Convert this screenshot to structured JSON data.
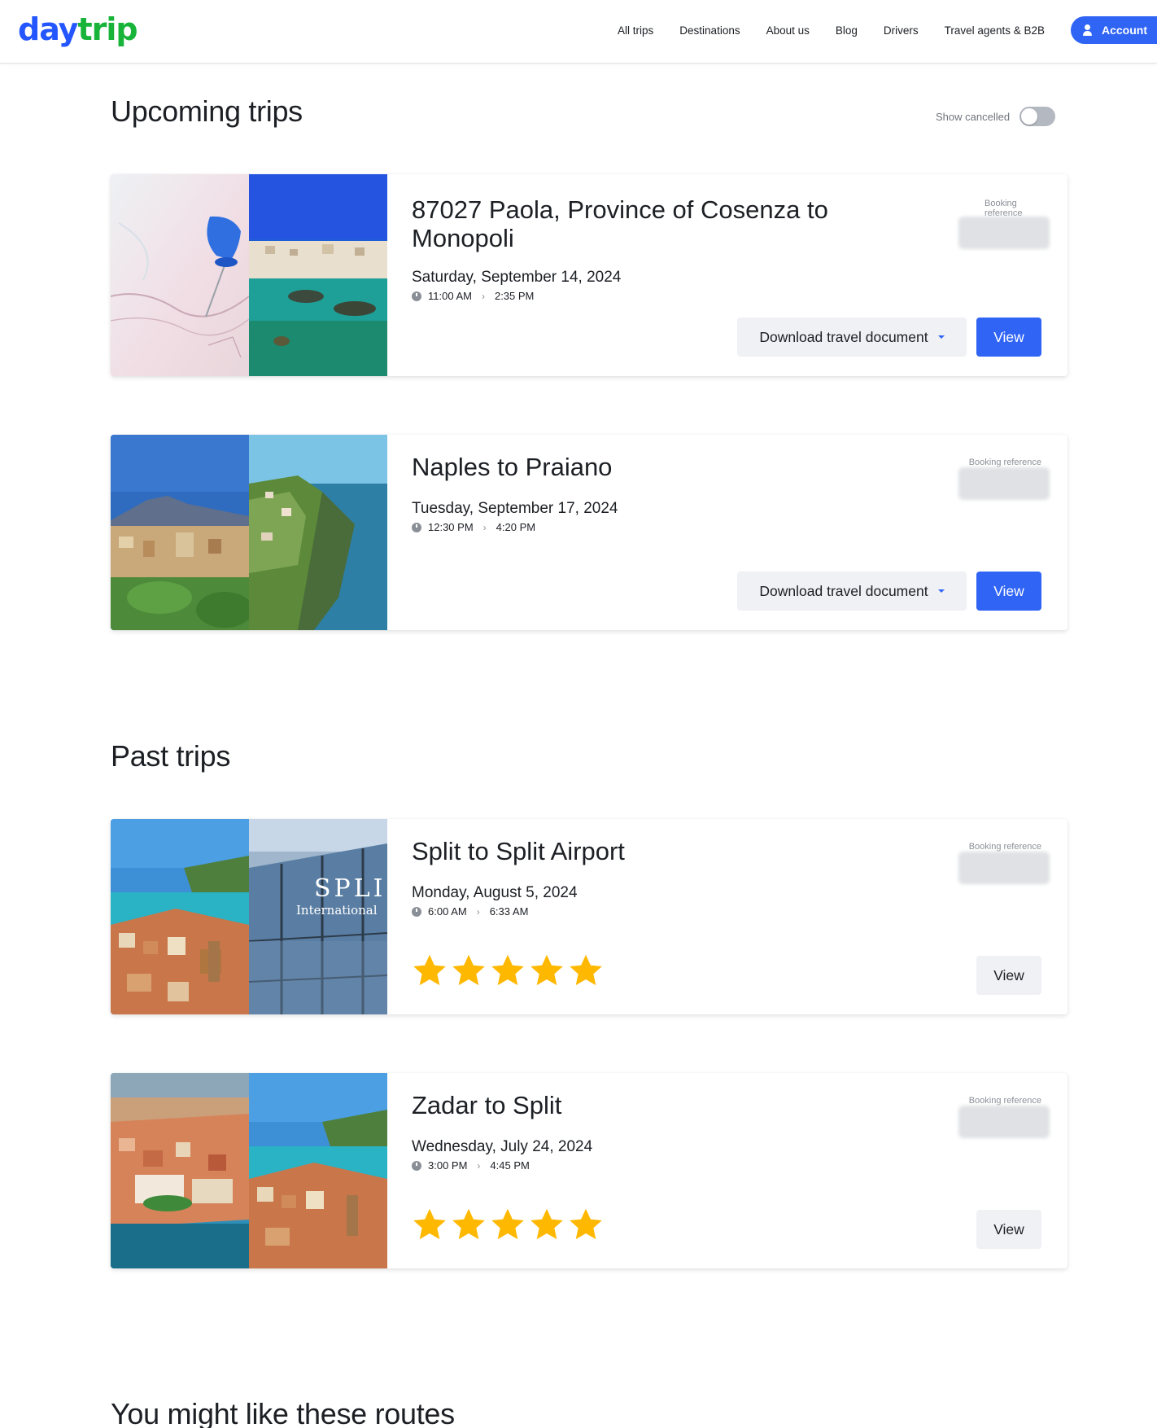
{
  "header": {
    "logo_part1": "day",
    "logo_part2": "trip",
    "nav": [
      "All trips",
      "Destinations",
      "About us",
      "Blog",
      "Drivers",
      "Travel agents & B2B"
    ],
    "account_label": "Account"
  },
  "upcoming": {
    "title": "Upcoming trips",
    "show_cancelled_label": "Show cancelled",
    "show_cancelled_on": false,
    "trips": [
      {
        "title": "87027 Paola, Province of Cosenza to Monopoli",
        "date": "Saturday, September 14, 2024",
        "depart": "11:00 AM",
        "arrive": "2:35 PM",
        "ref_label": "Booking reference",
        "download_label": "Download travel document",
        "view_label": "View"
      },
      {
        "title": "Naples to Praiano",
        "date": "Tuesday, September 17, 2024",
        "depart": "12:30 PM",
        "arrive": "4:20 PM",
        "ref_label": "Booking reference",
        "download_label": "Download travel document",
        "view_label": "View"
      }
    ]
  },
  "past": {
    "title": "Past trips",
    "trips": [
      {
        "title": "Split to Split Airport",
        "date": "Monday, August 5, 2024",
        "depart": "6:00 AM",
        "arrive": "6:33 AM",
        "ref_label": "Booking reference",
        "rating": 5,
        "view_label": "View",
        "airport_sign": "SPLI",
        "airport_sign_sub": "International"
      },
      {
        "title": "Zadar to Split",
        "date": "Wednesday, July 24, 2024",
        "depart": "3:00 PM",
        "arrive": "4:45 PM",
        "ref_label": "Booking reference",
        "rating": 5,
        "view_label": "View"
      }
    ]
  },
  "routes": {
    "title": "You might like these routes"
  },
  "colors": {
    "primary": "#2f64f5",
    "logo_blue": "#2456ff",
    "logo_green": "#18b43a",
    "star": "#ffb800"
  }
}
